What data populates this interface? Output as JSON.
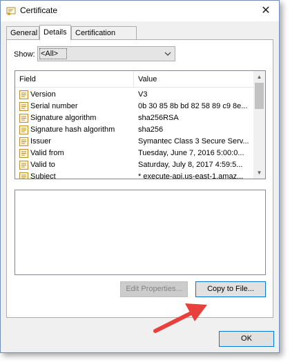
{
  "window": {
    "title": "Certificate",
    "close_glyph": "✕"
  },
  "tabs": [
    {
      "label": "General",
      "active": false
    },
    {
      "label": "Details",
      "active": true
    },
    {
      "label": "Certification Path",
      "active": false
    }
  ],
  "show": {
    "label": "Show:",
    "value": "<All>"
  },
  "list": {
    "columns": [
      "Field",
      "Value"
    ],
    "rows": [
      {
        "field": "Version",
        "value": "V3"
      },
      {
        "field": "Serial number",
        "value": "0b 30 85 8b bd 82 58 89 c9 8e..."
      },
      {
        "field": "Signature algorithm",
        "value": "sha256RSA"
      },
      {
        "field": "Signature hash algorithm",
        "value": "sha256"
      },
      {
        "field": "Issuer",
        "value": "Symantec Class 3 Secure Serv..."
      },
      {
        "field": "Valid from",
        "value": "Tuesday, June 7, 2016 5:00:0..."
      },
      {
        "field": "Valid to",
        "value": "Saturday, July 8, 2017 4:59:5..."
      },
      {
        "field": "Subject",
        "value": "* execute-api.us-east-1.amaz..."
      }
    ]
  },
  "buttons": {
    "edit_properties": "Edit Properties...",
    "copy_to_file": "Copy to File...",
    "ok": "OK"
  },
  "colors": {
    "annotation_arrow": "#e8403a",
    "focus_border": "#0078d7"
  }
}
